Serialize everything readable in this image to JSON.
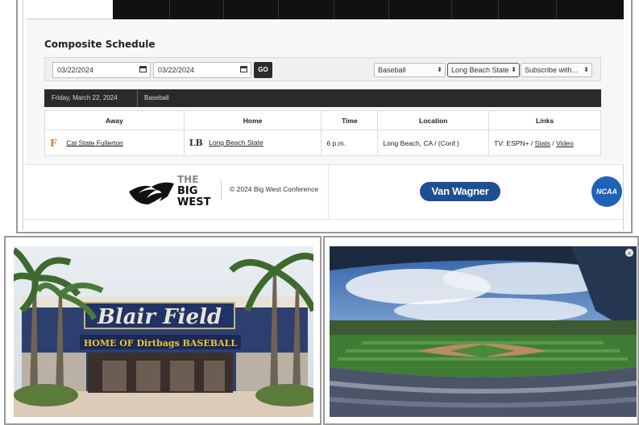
{
  "schedule": {
    "title": "Composite Schedule",
    "filters": {
      "start_date": "03/22/2024",
      "end_date": "03/22/2024",
      "go_label": "GO",
      "sport": "Baseball",
      "team": "Long Beach State",
      "subscribe": "Subscribe with..."
    },
    "date_bar": {
      "date": "Friday, March 22, 2024",
      "sport": "Baseball"
    },
    "columns": [
      "Away",
      "Home",
      "Time",
      "Location",
      "Links"
    ],
    "rows": [
      {
        "away": "Cal State Fullerton",
        "away_logo": "F",
        "home": "Long Beach State",
        "home_logo": "LB",
        "time": "6 p.m.",
        "location": "Long Beach, CA  / (Conf.)",
        "links_prefix": "TV: ESPN+  / ",
        "link_stats": "Stats",
        "links_sep": " / ",
        "link_video": "Video"
      }
    ]
  },
  "footer": {
    "logo_text_1": "THE",
    "logo_text_2": "BIG",
    "logo_text_3": "WEST",
    "copyright": "© 2024 Big West Conference",
    "sponsor": "Van Wagner",
    "ncaa": "NCAA"
  },
  "photos": {
    "left_sign": "Blair Field",
    "left_banner": "HOME OF Dirtbags BASEBALL"
  },
  "colors": {
    "accent_dark": "#2a2a2a",
    "van_wagner_blue": "#1d4f91",
    "ncaa_blue": "#1e63b8"
  }
}
